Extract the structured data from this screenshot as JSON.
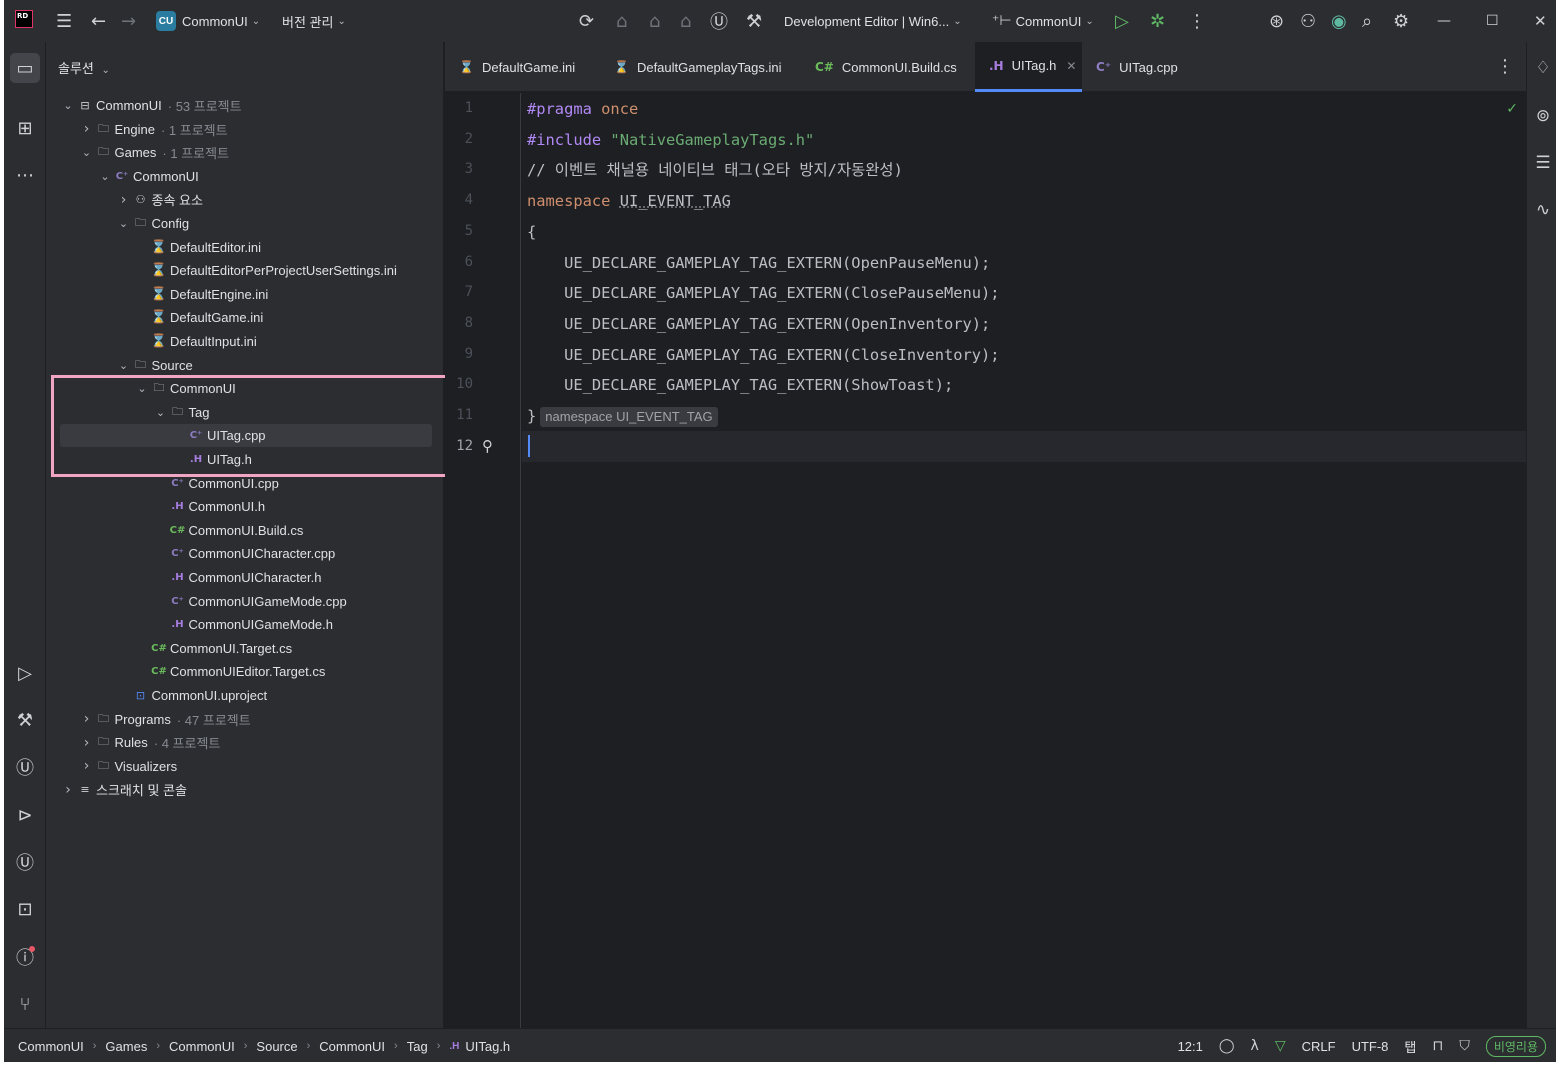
{
  "titlebar": {
    "logo": "RD",
    "project_badge": "CU",
    "project_name": "CommonUI",
    "vcs_label": "버전 관리",
    "config_label": "Development Editor | Win6...",
    "run_target": "CommonUI"
  },
  "solution": {
    "header": "솔루션",
    "tree": [
      {
        "label": "CommonUI",
        "meta": "· 53 프로젝트",
        "icon": "solution-icon",
        "depth": 0,
        "arrow": "down"
      },
      {
        "label": "Engine",
        "meta": "· 1 프로젝트",
        "icon": "folder-project-icon",
        "depth": 1,
        "arrow": "right"
      },
      {
        "label": "Games",
        "meta": "· 1 프로젝트",
        "icon": "folder-project-icon",
        "depth": 1,
        "arrow": "down"
      },
      {
        "label": "CommonUI",
        "meta": "",
        "icon": "cpp-project-icon",
        "depth": 2,
        "arrow": "down"
      },
      {
        "label": "종속 요소",
        "meta": "",
        "icon": "dependencies-icon",
        "depth": 3,
        "arrow": "right"
      },
      {
        "label": "Config",
        "meta": "",
        "icon": "folder-icon",
        "depth": 3,
        "arrow": "down"
      },
      {
        "label": "DefaultEditor.ini",
        "meta": "",
        "icon": "ini-file-icon",
        "depth": 4,
        "arrow": ""
      },
      {
        "label": "DefaultEditorPerProjectUserSettings.ini",
        "meta": "",
        "icon": "ini-file-icon",
        "depth": 4,
        "arrow": ""
      },
      {
        "label": "DefaultEngine.ini",
        "meta": "",
        "icon": "ini-file-icon",
        "depth": 4,
        "arrow": ""
      },
      {
        "label": "DefaultGame.ini",
        "meta": "",
        "icon": "ini-file-icon",
        "depth": 4,
        "arrow": ""
      },
      {
        "label": "DefaultInput.ini",
        "meta": "",
        "icon": "ini-file-icon",
        "depth": 4,
        "arrow": ""
      },
      {
        "label": "Source",
        "meta": "",
        "icon": "folder-icon",
        "depth": 3,
        "arrow": "down"
      },
      {
        "label": "CommonUI",
        "meta": "",
        "icon": "folder-icon",
        "depth": 4,
        "arrow": "down"
      },
      {
        "label": "Tag",
        "meta": "",
        "icon": "folder-icon",
        "depth": 5,
        "arrow": "down"
      },
      {
        "label": "UITag.cpp",
        "meta": "",
        "icon": "cpp-file-icon",
        "depth": 6,
        "arrow": "",
        "selected": true
      },
      {
        "label": "UITag.h",
        "meta": "",
        "icon": "h-file-icon",
        "depth": 6,
        "arrow": ""
      },
      {
        "label": "CommonUI.cpp",
        "meta": "",
        "icon": "cpp-file-icon",
        "depth": 5,
        "arrow": ""
      },
      {
        "label": "CommonUI.h",
        "meta": "",
        "icon": "h-file-icon",
        "depth": 5,
        "arrow": ""
      },
      {
        "label": "CommonUI.Build.cs",
        "meta": "",
        "icon": "cs-file-icon",
        "depth": 5,
        "arrow": ""
      },
      {
        "label": "CommonUICharacter.cpp",
        "meta": "",
        "icon": "cpp-file-icon",
        "depth": 5,
        "arrow": ""
      },
      {
        "label": "CommonUICharacter.h",
        "meta": "",
        "icon": "h-file-icon",
        "depth": 5,
        "arrow": ""
      },
      {
        "label": "CommonUIGameMode.cpp",
        "meta": "",
        "icon": "cpp-file-icon",
        "depth": 5,
        "arrow": ""
      },
      {
        "label": "CommonUIGameMode.h",
        "meta": "",
        "icon": "h-file-icon",
        "depth": 5,
        "arrow": ""
      },
      {
        "label": "CommonUI.Target.cs",
        "meta": "",
        "icon": "cs-file-icon",
        "depth": 4,
        "arrow": ""
      },
      {
        "label": "CommonUIEditor.Target.cs",
        "meta": "",
        "icon": "cs-file-icon",
        "depth": 4,
        "arrow": ""
      },
      {
        "label": "CommonUI.uproject",
        "meta": "",
        "icon": "uproject-icon",
        "depth": 3,
        "arrow": ""
      },
      {
        "label": "Programs",
        "meta": "· 47 프로젝트",
        "icon": "folder-project-icon",
        "depth": 1,
        "arrow": "right"
      },
      {
        "label": "Rules",
        "meta": "· 4 프로젝트",
        "icon": "folder-project-icon",
        "depth": 1,
        "arrow": "right"
      },
      {
        "label": "Visualizers",
        "meta": "",
        "icon": "folder-project-icon",
        "depth": 1,
        "arrow": "right"
      },
      {
        "label": "스크래치 및 콘솔",
        "meta": "",
        "icon": "scratches-icon",
        "depth": 0,
        "arrow": "right"
      }
    ]
  },
  "tabs": [
    {
      "label": "DefaultGame.ini",
      "icon": "ini-file-icon"
    },
    {
      "label": "DefaultGameplayTags.ini",
      "icon": "ini-file-icon"
    },
    {
      "label": "CommonUI.Build.cs",
      "icon": "cs-file-icon"
    },
    {
      "label": "UITag.h",
      "icon": "h-file-icon",
      "active": true
    },
    {
      "label": "UITag.cpp",
      "icon": "cpp-file-icon"
    }
  ],
  "editor": {
    "line_numbers": [
      "1",
      "2",
      "3",
      "4",
      "5",
      "6",
      "7",
      "8",
      "9",
      "10",
      "11",
      "12"
    ],
    "lines": [
      {
        "parts": [
          [
            "kw-pre",
            "#pragma"
          ],
          [
            "",
            "&nbsp;"
          ],
          [
            "kw",
            "once"
          ]
        ]
      },
      {
        "parts": [
          [
            "kw-pre",
            "#include"
          ],
          [
            "",
            "&nbsp;"
          ],
          [
            "str",
            "\"NativeGameplayTags.h\""
          ]
        ]
      },
      {
        "parts": [
          [
            "cmt",
            "// 이벤트 채널용 네이티브 태그(오타 방지/자동완성)"
          ]
        ]
      },
      {
        "parts": [
          [
            "kw",
            "namespace"
          ],
          [
            "",
            "&nbsp;"
          ],
          [
            "ns",
            "UI_EVENT_TAG"
          ]
        ]
      },
      {
        "parts": [
          [
            "",
            "{"
          ]
        ]
      },
      {
        "parts": [
          [
            "",
            "    UE_DECLARE_GAMEPLAY_TAG_EXTERN(OpenPauseMenu);"
          ]
        ]
      },
      {
        "parts": [
          [
            "",
            "    UE_DECLARE_GAMEPLAY_TAG_EXTERN(ClosePauseMenu);"
          ]
        ]
      },
      {
        "parts": [
          [
            "",
            "    UE_DECLARE_GAMEPLAY_TAG_EXTERN(OpenInventory);"
          ]
        ]
      },
      {
        "parts": [
          [
            "",
            "    UE_DECLARE_GAMEPLAY_TAG_EXTERN(CloseInventory);"
          ]
        ]
      },
      {
        "parts": [
          [
            "",
            "    UE_DECLARE_GAMEPLAY_TAG_EXTERN(ShowToast);"
          ]
        ]
      },
      {
        "parts": [
          [
            "",
            "}"
          ]
        ],
        "hint": "namespace UI_EVENT_TAG"
      },
      {
        "parts": []
      }
    ]
  },
  "statusbar": {
    "breadcrumbs": [
      "CommonUI",
      "Games",
      "CommonUI",
      "Source",
      "CommonUI",
      "Tag",
      "UITag.h"
    ],
    "position": "12:1",
    "line_ending": "CRLF",
    "encoding": "UTF-8",
    "indent": "탭",
    "mode_badge": "비영리용"
  },
  "colors": {
    "background": "#1e1f22",
    "panel": "#2b2d30",
    "accent": "#548af7",
    "highlight_box": "#f0a6c3"
  }
}
